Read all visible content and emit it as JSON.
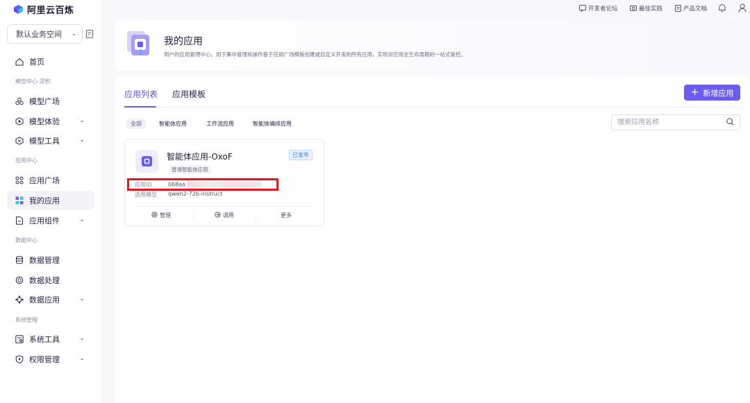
{
  "brand": {
    "name": "阿里云百炼"
  },
  "workspace": {
    "label": "默认业务空间"
  },
  "sidebar": {
    "home": "首页",
    "section_model": "模型中心-灵积",
    "model_square": "模型广场",
    "model_experience": "模型体验",
    "model_tools": "模型工具",
    "section_app": "应用中心",
    "app_square": "应用广场",
    "my_apps": "我的应用",
    "app_components": "应用组件",
    "section_data": "数据中心",
    "data_management": "数据管理",
    "data_processing": "数据处理",
    "data_application": "数据应用",
    "section_system": "系统管理",
    "system_tools": "系统工具",
    "permission_management": "权限管理"
  },
  "topbar": {
    "forum": "开发者论坛",
    "best_practice": "最佳实践",
    "docs": "产品文档"
  },
  "header": {
    "title": "我的应用",
    "description": "用户的应用管理中心，用于集中管理和操作基于应用广场模板创建或自定义开发的所有应用，实现对应用全生命周期的一站式管控。"
  },
  "tabs": {
    "list": "应用列表",
    "templates": "应用模板"
  },
  "new_button": "新增应用",
  "filters": {
    "all": "全部",
    "agent": "智能体应用",
    "workflow": "工作流应用",
    "orchestration": "智能体编排应用"
  },
  "search": {
    "placeholder": "搜索应用名称",
    "value": ""
  },
  "app_card": {
    "title": "智能体应用-OxoF",
    "status": "已发布",
    "type": "普通智能体应用",
    "id_label": "应用ID",
    "id_value": "068aa",
    "model_label": "选用模型",
    "model_value": "qwen2-72b-instruct",
    "actions": {
      "manage": "管理",
      "invoke": "调用",
      "more": "更多"
    }
  },
  "colors": {
    "accent": "#6b5cf2",
    "highlight": "#e3141a",
    "published": "#3a7ef0"
  }
}
